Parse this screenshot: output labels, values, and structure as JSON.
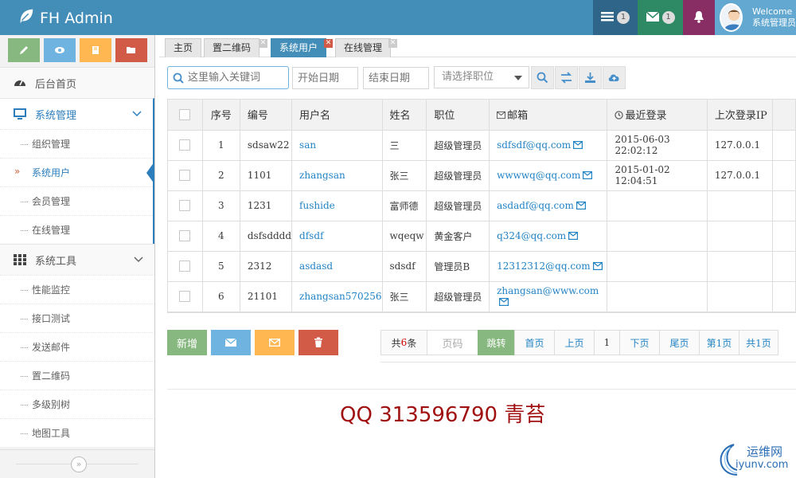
{
  "app": {
    "title": "FH Admin",
    "welcome_line1": "Welcome",
    "welcome_line2": "系统管理员"
  },
  "header": {
    "tasks_count": "1",
    "messages_count": "1"
  },
  "sidebar": {
    "home": "后台首页",
    "system_mgmt": "系统管理",
    "system_items": [
      "组织管理",
      "系统用户",
      "会员管理",
      "在线管理"
    ],
    "system_tools": "系统工具",
    "tool_items": [
      "性能监控",
      "接口测试",
      "发送邮件",
      "置二维码",
      "多级别树",
      "地图工具"
    ]
  },
  "tabs": [
    {
      "label": "主页"
    },
    {
      "label": "置二维码"
    },
    {
      "label": "系统用户"
    },
    {
      "label": "在线管理"
    }
  ],
  "toolbar": {
    "search_placeholder": "这里输入关键词",
    "start_date": "开始日期",
    "end_date": "结束日期",
    "role_select": "请选择职位"
  },
  "table": {
    "headers": [
      "序号",
      "编号",
      "用户名",
      "姓名",
      "职位",
      "邮箱",
      "最近登录",
      "上次登录IP"
    ],
    "rows": [
      {
        "no": "1",
        "code": "sdsaw22",
        "username": "san",
        "name": "三",
        "role": "超级管理员",
        "email": "sdfsdf@qq.com",
        "last_login": "2015-06-03 22:02:12",
        "ip": "127.0.0.1"
      },
      {
        "no": "2",
        "code": "1101",
        "username": "zhangsan",
        "name": "张三",
        "role": "超级管理员",
        "email": "wwwwq@qq.com",
        "last_login": "2015-01-02 12:04:51",
        "ip": "127.0.0.1"
      },
      {
        "no": "3",
        "code": "1231",
        "username": "fushide",
        "name": "富师德",
        "role": "超级管理员",
        "email": "asdadf@qq.com",
        "last_login": "",
        "ip": ""
      },
      {
        "no": "4",
        "code": "dsfsdddd",
        "username": "dfsdf",
        "name": "wqeqw",
        "role": "黄金客户",
        "email": "q324@qq.com",
        "last_login": "",
        "ip": ""
      },
      {
        "no": "5",
        "code": "2312",
        "username": "asdasd",
        "name": "sdsdf",
        "role": "管理员B",
        "email": "12312312@qq.com",
        "last_login": "",
        "ip": ""
      },
      {
        "no": "6",
        "code": "21101",
        "username": "zhangsan570256",
        "name": "张三",
        "role": "超级管理员",
        "email": "zhangsan@www.com",
        "last_login": "",
        "ip": ""
      }
    ]
  },
  "actions": {
    "add": "新增"
  },
  "pager": {
    "total_prefix": "共",
    "total_count": "6",
    "total_suffix": "条",
    "page_input_placeholder": "页码",
    "go": "跳转",
    "first": "首页",
    "prev": "上页",
    "current": "1",
    "next": "下页",
    "last": "尾页",
    "page_of": "第1页",
    "pages_total": "共1页"
  },
  "watermark": "QQ 313596790 青苔",
  "site_logo": {
    "line1": "运维网",
    "line2": "iyunv.com"
  }
}
